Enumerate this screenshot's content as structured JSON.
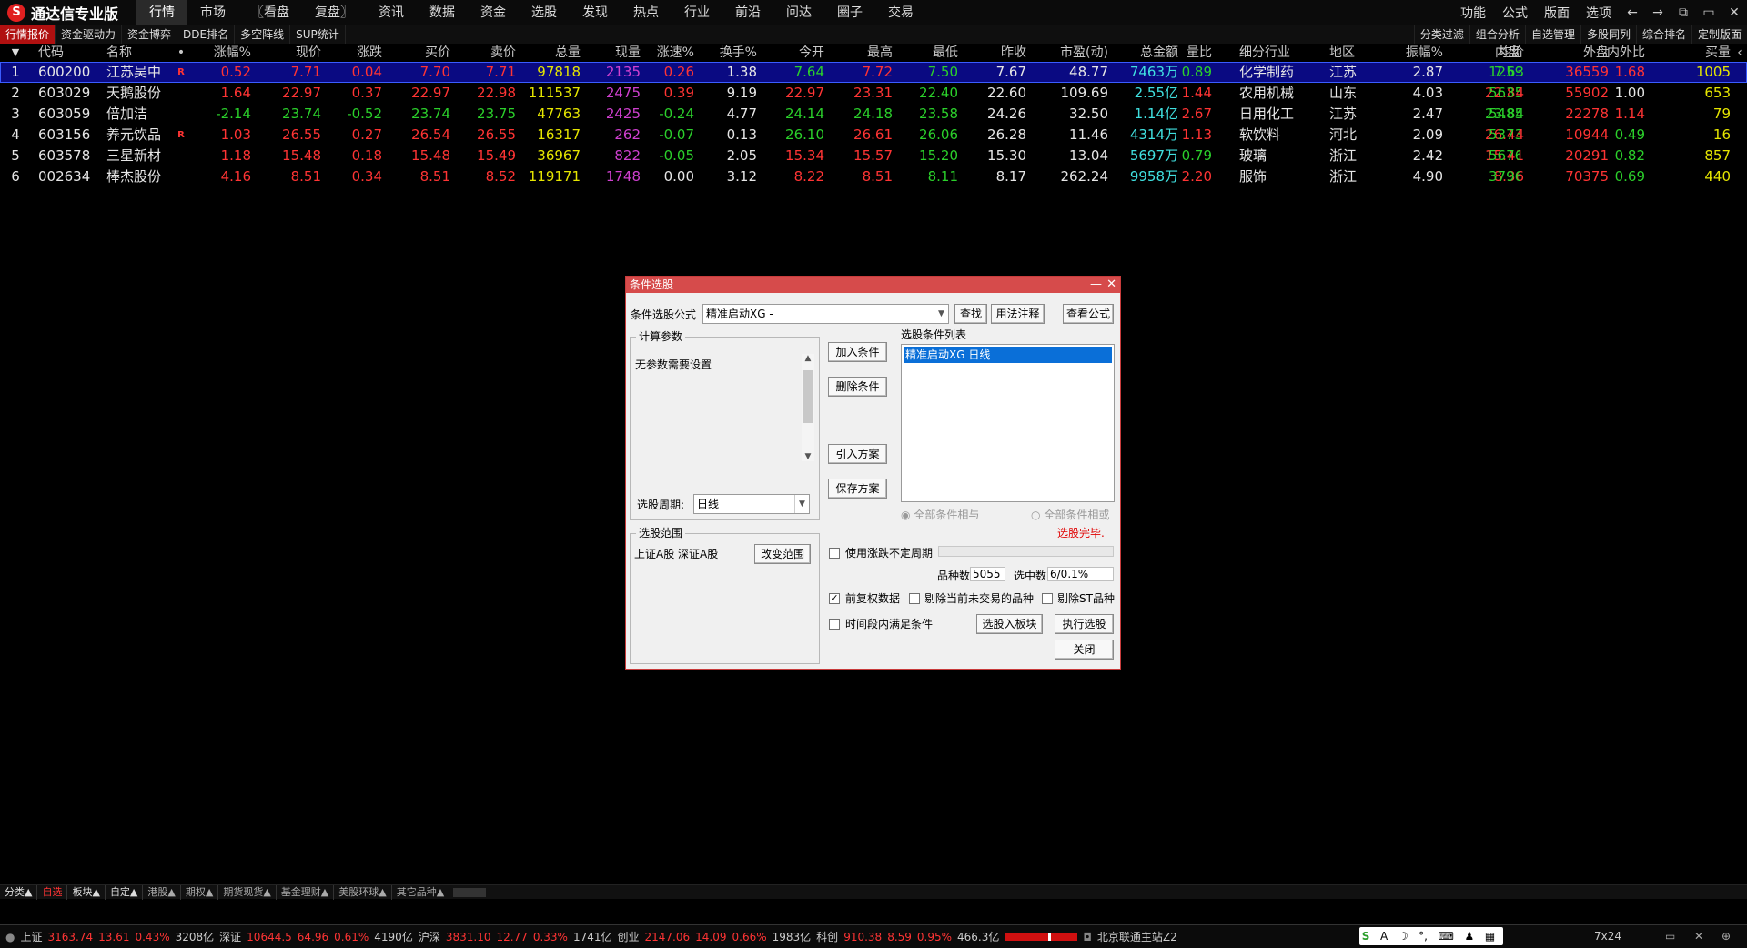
{
  "app": {
    "logo_glyph": "S",
    "title": "通达信专业版"
  },
  "menu": [
    "行情",
    "市场",
    "〖看盘",
    "复盘〗",
    "资讯",
    "数据",
    "资金",
    "选股",
    "发现",
    "热点",
    "行业",
    "前沿",
    "问达",
    "圈子",
    "交易"
  ],
  "menu_active": 0,
  "top_right": [
    "功能",
    "公式",
    "版面",
    "选项"
  ],
  "window_controls": [
    "←",
    "→",
    "⧉",
    "▭",
    "✕"
  ],
  "sub_tabs_left": [
    "行情报价",
    "资金驱动力",
    "资金博弈",
    "DDE排名",
    "多空阵线",
    "SUP统计"
  ],
  "sub_tabs_right": [
    "分类过滤",
    "组合分析",
    "自选管理",
    "多股同列",
    "综合排名",
    "定制版面"
  ],
  "table": {
    "columns": [
      "",
      "代码",
      "名称",
      "•",
      "涨幅%",
      "现价",
      "涨跌",
      "买价",
      "卖价",
      "总量",
      "现量",
      "涨速%",
      "换手%",
      "今开",
      "最高",
      "最低",
      "昨收",
      "市盈(动)",
      "总金额",
      "量比",
      "细分行业",
      "地区",
      "振幅%",
      "均价",
      "内盘",
      "外盘",
      "内外比",
      "买量"
    ],
    "header_glyphs": {
      "first": "▼",
      "last": "‹"
    },
    "rows": [
      [
        "1",
        "600200",
        "江苏吴中",
        "R",
        "0.52",
        "7.71",
        "0.04",
        "7.70",
        "7.71",
        "97818",
        "2135",
        "0.26",
        "1.38",
        "7.64",
        "7.72",
        "7.50",
        "7.67",
        "48.77",
        "7463万",
        "0.89",
        "化学制药",
        "江苏",
        "2.87",
        "7.63",
        "1259",
        "36559",
        "1.68",
        "1005"
      ],
      [
        "2",
        "603029",
        "天鹅股份",
        "",
        "1.64",
        "22.97",
        "0.37",
        "22.97",
        "22.98",
        "111537",
        "2475",
        "0.39",
        "9.19",
        "22.97",
        "23.31",
        "22.40",
        "22.60",
        "109.69",
        "2.55亿",
        "1.44",
        "农用机械",
        "山东",
        "4.03",
        "22.84",
        "5635",
        "55902",
        "1.00",
        "653"
      ],
      [
        "3",
        "603059",
        "倍加洁",
        "",
        "-2.14",
        "23.74",
        "-0.52",
        "23.74",
        "23.75",
        "47763",
        "2425",
        "-0.24",
        "4.77",
        "24.14",
        "24.18",
        "23.58",
        "24.26",
        "32.50",
        "1.14亿",
        "2.67",
        "日用化工",
        "江苏",
        "2.47",
        "23.84",
        "5485",
        "22278",
        "1.14",
        "79"
      ],
      [
        "4",
        "603156",
        "养元饮品",
        "R",
        "1.03",
        "26.55",
        "0.27",
        "26.54",
        "26.55",
        "16317",
        "262",
        "-0.07",
        "0.13",
        "26.10",
        "26.61",
        "26.06",
        "26.28",
        "11.46",
        "4314万",
        "1.13",
        "软饮料",
        "河北",
        "2.09",
        "26.44",
        "5373",
        "10944",
        "0.49",
        "16"
      ],
      [
        "5",
        "603578",
        "三星新材",
        "",
        "1.18",
        "15.48",
        "0.18",
        "15.48",
        "15.49",
        "36967",
        "822",
        "-0.05",
        "2.05",
        "15.34",
        "15.57",
        "15.20",
        "15.30",
        "13.04",
        "5697万",
        "0.79",
        "玻璃",
        "浙江",
        "2.42",
        "15.41",
        "5676",
        "20291",
        "0.82",
        "857"
      ],
      [
        "6",
        "002634",
        "棒杰股份",
        "",
        "4.16",
        "8.51",
        "0.34",
        "8.51",
        "8.52",
        "119171",
        "1748",
        "0.00",
        "3.12",
        "8.22",
        "8.51",
        "8.11",
        "8.17",
        "262.24",
        "9958万",
        "2.20",
        "服饰",
        "浙江",
        "4.90",
        "8.36",
        "3796",
        "70375",
        "0.69",
        "440"
      ]
    ],
    "selected_row": 0
  },
  "dialog": {
    "title": "条件选股",
    "formula_label": "条件选股公式",
    "formula_value": "精准启动XG  -",
    "btn_find": "查找",
    "btn_usage": "用法注释",
    "btn_view": "查看公式",
    "calc_params_group": "计算参数",
    "no_params": "无参数需要设置",
    "period_label": "选股周期:",
    "period_value": "日线",
    "btn_add": "加入条件",
    "btn_delete": "删除条件",
    "btn_import": "引入方案",
    "btn_save": "保存方案",
    "cond_list_label": "选股条件列表",
    "cond_items": [
      "精准启动XG  日线"
    ],
    "radio_and": "全部条件相与",
    "radio_or": "全部条件相或",
    "status_done": "选股完毕.",
    "scope_group": "选股范围",
    "scope_value": "上证A股 深证A股",
    "btn_change_scope": "改变范围",
    "chk_uncertain": "使用涨跌不定周期",
    "count_label": "品种数",
    "count_value": "5055",
    "selected_label": "选中数",
    "selected_value": "6/0.1%",
    "chk_fq": "前复权数据",
    "chk_fq_checked": true,
    "chk_no_trade": "剔除当前未交易的品种",
    "chk_st": "剔除ST品种",
    "chk_period": "时间段内满足条件",
    "btn_to_block": "选股入板块",
    "btn_execute": "执行选股",
    "btn_close": "关闭"
  },
  "bottom_tabs": [
    "分类▲",
    "自选",
    "板块▲",
    "自定▲",
    "港股▲",
    "期权▲",
    "期货现货▲",
    "基金理财▲",
    "美股环球▲",
    "其它品种▲"
  ],
  "bottom_active": 1,
  "status_bar": {
    "sh": {
      "name": "上证",
      "value": "3163.74",
      "chg": "13.61",
      "pct": "0.43%",
      "amt": "3208亿"
    },
    "sz": {
      "name": "深证",
      "value": "10644.5",
      "chg": "64.96",
      "pct": "0.61%",
      "amt": "4190亿"
    },
    "hs": {
      "name": "沪深",
      "value": "3831.10",
      "chg": "12.77",
      "pct": "0.33%",
      "amt": "1741亿"
    },
    "cy": {
      "name": "创业",
      "value": "2147.06",
      "chg": "14.09",
      "pct": "0.66%",
      "amt": "1983亿"
    },
    "kc": {
      "name": "科创",
      "value": "910.38",
      "chg": "8.59",
      "pct": "0.95%",
      "amt": "466.3亿"
    },
    "server": "北京联通主站Z2",
    "time_mode": "7x24"
  }
}
